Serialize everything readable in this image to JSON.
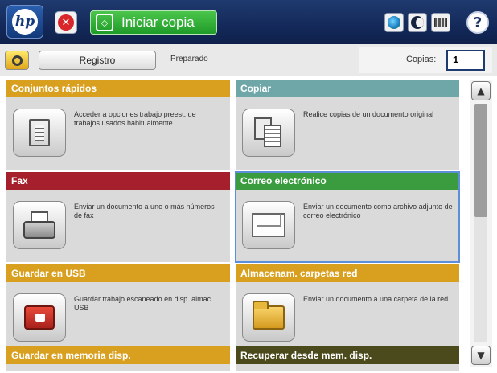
{
  "topbar": {
    "logo_text": "hp",
    "logo_icon": "hp-logo-icon",
    "stop_icon": "stop-icon",
    "start": {
      "icon": "start-copy-icon",
      "label": "Iniciar copia"
    },
    "network_icon": "network-globe-icon",
    "sleep_icon": "sleep-icon",
    "keyboard_icon": "keyboard-icon",
    "help_label": "?"
  },
  "statusbar": {
    "home_icon": "home-icon",
    "registro_label": "Registro",
    "status_text": "Preparado",
    "copies_label": "Copias:",
    "copies_value": "1"
  },
  "tiles": [
    {
      "title": "Conjuntos rápidos",
      "description": "Acceder a opciones trabajo preest. de trabajos usados habitualmente",
      "header_color": "#d9a020",
      "icon": "quick-sets-icon"
    },
    {
      "title": "Copiar",
      "description": "Realice copias de un documento original",
      "header_color": "#6fa6a8",
      "icon": "copy-icon"
    },
    {
      "title": "Fax",
      "description": "Enviar un documento a uno o más números de fax",
      "header_color": "#a61f2d",
      "icon": "fax-icon"
    },
    {
      "title": "Correo electrónico",
      "description": "Enviar un documento como archivo adjunto de correo electrónico",
      "header_color": "#3a9c3e",
      "icon": "email-icon"
    },
    {
      "title": "Guardar en USB",
      "description": "Guardar trabajo escaneado en disp. almac. USB",
      "header_color": "#d9a020",
      "icon": "usb-save-icon"
    },
    {
      "title": "Almacenam. carpetas red",
      "description": "Enviar un documento a una carpeta de la red",
      "header_color": "#d9a020",
      "icon": "network-folder-icon"
    },
    {
      "title": "Guardar en memoria disp.",
      "description": "",
      "header_color": "#d9a020",
      "icon": ""
    },
    {
      "title": "Recuperar desde mem. disp.",
      "description": "",
      "header_color": "#4b4a1c",
      "icon": ""
    }
  ],
  "scrollbar": {
    "up_label": "▲",
    "down_label": "▼"
  }
}
